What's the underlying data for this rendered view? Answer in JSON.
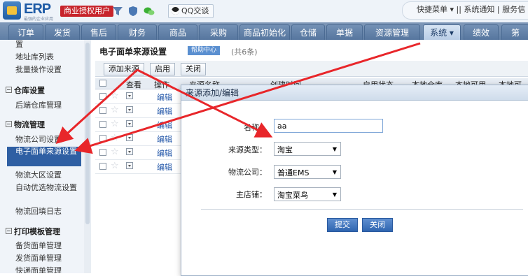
{
  "topbar": {
    "logo_text": "ERP",
    "logo_sub": "最强的企业应用",
    "license_badge": "商业授权用户",
    "qq_label": "QQ交谈",
    "right_text": "快捷菜单 ▾ || 系统通知 | 服务信"
  },
  "nav": {
    "items": [
      "订单",
      "发货",
      "售后",
      "财务",
      "商品",
      "采购",
      "商品初始化",
      "仓储",
      "单据",
      "资源管理",
      "系统 ▾",
      "绩效",
      "第"
    ]
  },
  "sidebar": {
    "cut_item": "置",
    "items_top": [
      "地址库列表",
      "批量操作设置"
    ],
    "group_warehouse": "仓库设置",
    "warehouse_items": [
      "后端仓库管理"
    ],
    "group_logistics": "物流管理",
    "logistics_items": [
      "物流公司设置",
      "电子面单来源设置",
      "物流大区设置",
      "自动优选物流设置",
      "物流回填日志"
    ],
    "group_print": "打印模板管理",
    "print_items": [
      "备货面单管理",
      "发货面单管理",
      "快递面单管理"
    ]
  },
  "content": {
    "title": "电子面单来源设置",
    "help_badge": "帮助中心",
    "count": "(共6条)",
    "toolbar": {
      "add_label": "添加来源",
      "enable_label": "启用",
      "close_label": "关闭"
    },
    "table_headers": [
      "查看",
      "操作",
      "来源名称",
      "创建时间",
      "启用状态",
      "本地仓库",
      "本地可用",
      "本地可"
    ],
    "row_edit_label": "编辑",
    "row_count": 6
  },
  "modal": {
    "title": "来源添加/编辑",
    "name_label": "名称：",
    "name_value": "aa",
    "type_label": "来源类型：",
    "type_value": "淘宝",
    "company_label": "物流公司：",
    "company_value": "普通EMS",
    "shop_label": "主店铺：",
    "shop_value": "淘宝菜鸟",
    "submit_label": "提交",
    "close_label": "关闭"
  },
  "colors": {
    "nav_bg": "#6a87ad",
    "sidebar_active": "#2f5fa3",
    "annotation_arrow": "#e8262a",
    "license_badge": "#c7242b"
  }
}
